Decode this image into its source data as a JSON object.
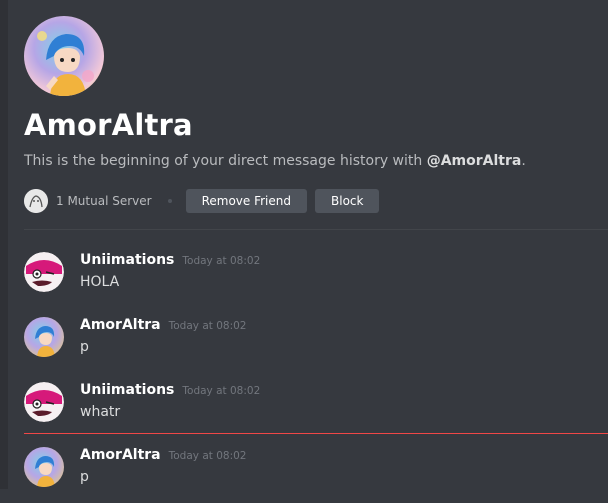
{
  "profile": {
    "name": "AmorAltra",
    "intro_prefix": "This is the beginning of your direct message history with",
    "intro_mention": "@AmorAltra",
    "intro_suffix": ".",
    "mutual_servers": "1 Mutual Server",
    "remove_friend_label": "Remove Friend",
    "block_label": "Block"
  },
  "messages": [
    {
      "author": "Uniimations",
      "time": "Today at 08:02",
      "text": "HOLA",
      "avatar": "pink-round-character-avatar"
    },
    {
      "author": "AmorAltra",
      "time": "Today at 08:02",
      "text": "p",
      "avatar": "blue-haired-character-avatar"
    },
    {
      "author": "Uniimations",
      "time": "Today at 08:02",
      "text": "whatr",
      "avatar": "pink-round-character-avatar"
    },
    {
      "author": "AmorAltra",
      "time": "Today at 08:02",
      "text": "p",
      "avatar": "blue-haired-character-avatar"
    }
  ],
  "colors": {
    "background": "#36393f",
    "button": "#4f545c",
    "new_messages_line": "#f04747",
    "username": "#ffffff",
    "timestamp": "#72767d"
  }
}
